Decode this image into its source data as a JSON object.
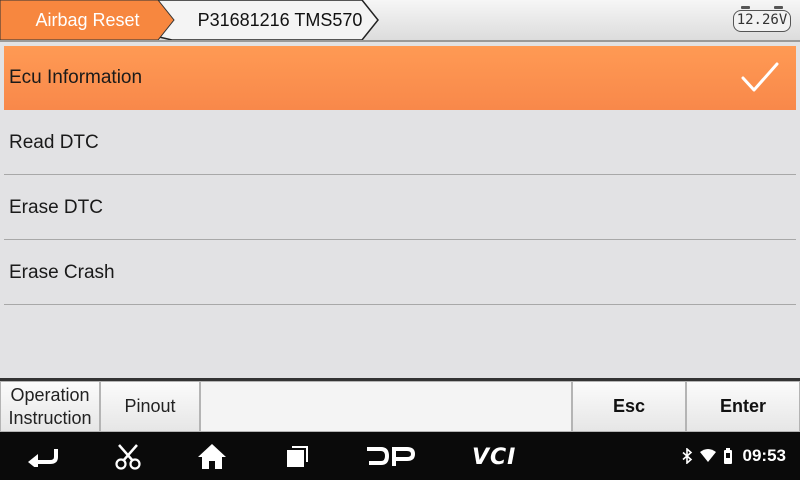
{
  "header": {
    "crumbs": [
      "Airbag Reset",
      "P31681216 TMS570"
    ],
    "battery_voltage": "12.26V",
    "accent_color": "#f7873f"
  },
  "menu": {
    "items": [
      {
        "label": "Ecu Information",
        "selected": true
      },
      {
        "label": "Read DTC",
        "selected": false
      },
      {
        "label": "Erase DTC",
        "selected": false
      },
      {
        "label": "Erase Crash",
        "selected": false
      }
    ],
    "selected_icon": "checkmark-icon"
  },
  "buttons": {
    "operation_instruction": [
      "Operation",
      "Instruction"
    ],
    "pinout": "Pinout",
    "esc": "Esc",
    "enter": "Enter"
  },
  "navbar": {
    "icons": [
      "back-icon",
      "scissors-icon",
      "home-icon",
      "recent-apps-icon",
      "dp-icon",
      "vci-icon"
    ],
    "dp_label": "DP",
    "vci_label": "VCI",
    "status_icons": [
      "bluetooth-icon",
      "wifi-icon",
      "battery-icon"
    ],
    "time": "09:53"
  }
}
